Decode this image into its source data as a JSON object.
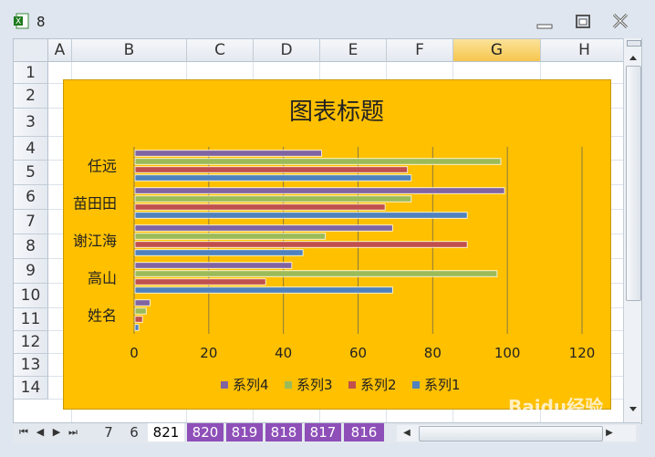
{
  "window": {
    "title": "8"
  },
  "columns": [
    "A",
    "B",
    "C",
    "D",
    "E",
    "F",
    "G",
    "H"
  ],
  "selected_column": "G",
  "rows": [
    "1",
    "2",
    "3",
    "4",
    "5",
    "6",
    "7",
    "8",
    "9",
    "10",
    "11",
    "12",
    "13",
    "14"
  ],
  "chart_data": {
    "type": "bar",
    "orientation": "horizontal",
    "title": "图表标题",
    "categories": [
      "姓名",
      "高山",
      "谢江海",
      "苗田田",
      "任远"
    ],
    "xlim": [
      0,
      120
    ],
    "xticks": [
      "0",
      "20",
      "40",
      "60",
      "80",
      "100",
      "120"
    ],
    "series": [
      {
        "name": "系列1",
        "color": "#4f81bd",
        "values": [
          1,
          69,
          45,
          89,
          74
        ]
      },
      {
        "name": "系列2",
        "color": "#c0504d",
        "values": [
          2,
          35,
          89,
          67,
          73
        ]
      },
      {
        "name": "系列3",
        "color": "#9bbb59",
        "values": [
          3,
          97,
          51,
          74,
          98
        ]
      },
      {
        "name": "系列4",
        "color": "#8064a2",
        "values": [
          4,
          42,
          69,
          99,
          50
        ]
      }
    ],
    "legend_order": [
      "系列4",
      "系列3",
      "系列2",
      "系列1"
    ],
    "legend_position": "bottom",
    "grid": true
  },
  "sheet_tabs": [
    {
      "label": "7",
      "style": "plain"
    },
    {
      "label": "6",
      "style": "plain"
    },
    {
      "label": "821",
      "style": "active"
    },
    {
      "label": "820",
      "style": "purple"
    },
    {
      "label": "819",
      "style": "purple"
    },
    {
      "label": "818",
      "style": "purple"
    },
    {
      "label": "817",
      "style": "purple"
    },
    {
      "label": "816",
      "style": "purple"
    }
  ],
  "watermark": "Baidu经验"
}
